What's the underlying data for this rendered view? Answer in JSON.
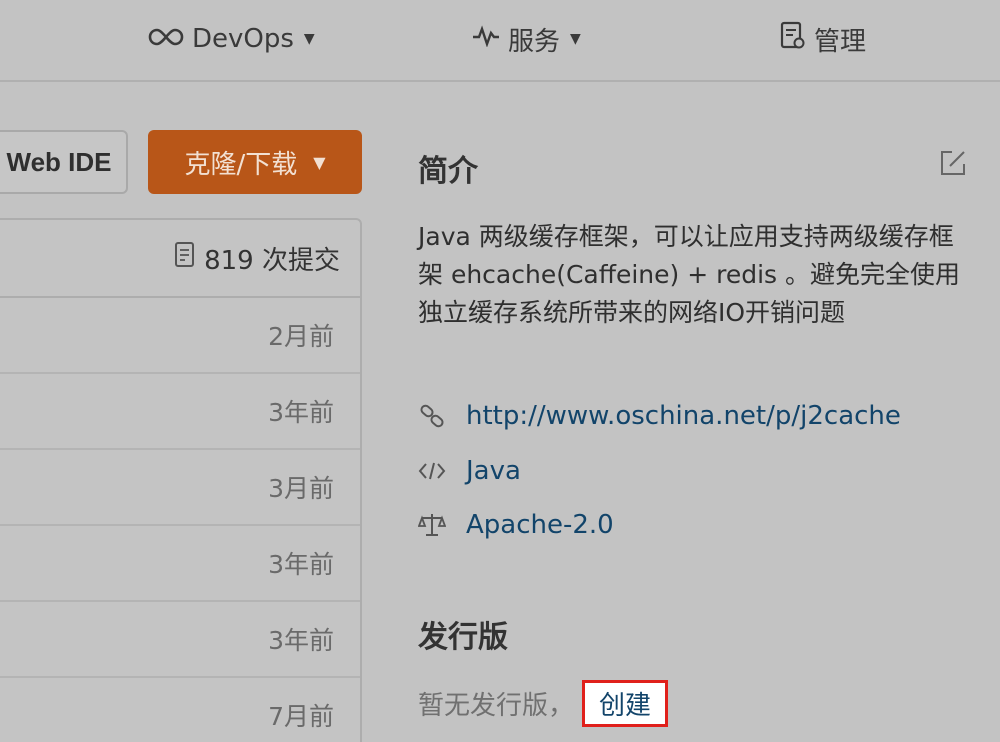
{
  "nav": {
    "devops": "DevOps",
    "services": "服务",
    "manage": "管理"
  },
  "buttons": {
    "web_ide": "Web IDE",
    "clone": "克隆/下载"
  },
  "commits": {
    "count_label": "819 次提交",
    "rows": [
      "2月前",
      "3年前",
      "3月前",
      "3年前",
      "3年前",
      "7月前"
    ]
  },
  "intro": {
    "title": "简介",
    "description": "Java 两级缓存框架，可以让应用支持两级缓存框架 ehcache(Caffeine) + redis 。避免完全使用独立缓存系统所带来的网络IO开销问题",
    "url": "http://www.oschina.net/p/j2cache",
    "language": "Java",
    "license": "Apache-2.0"
  },
  "releases": {
    "title": "发行版",
    "empty_text": "暂无发行版，",
    "create_label": "创建"
  },
  "colors": {
    "clone_button": "#b85618",
    "link": "#12446a",
    "highlight_border": "#e0201b"
  }
}
